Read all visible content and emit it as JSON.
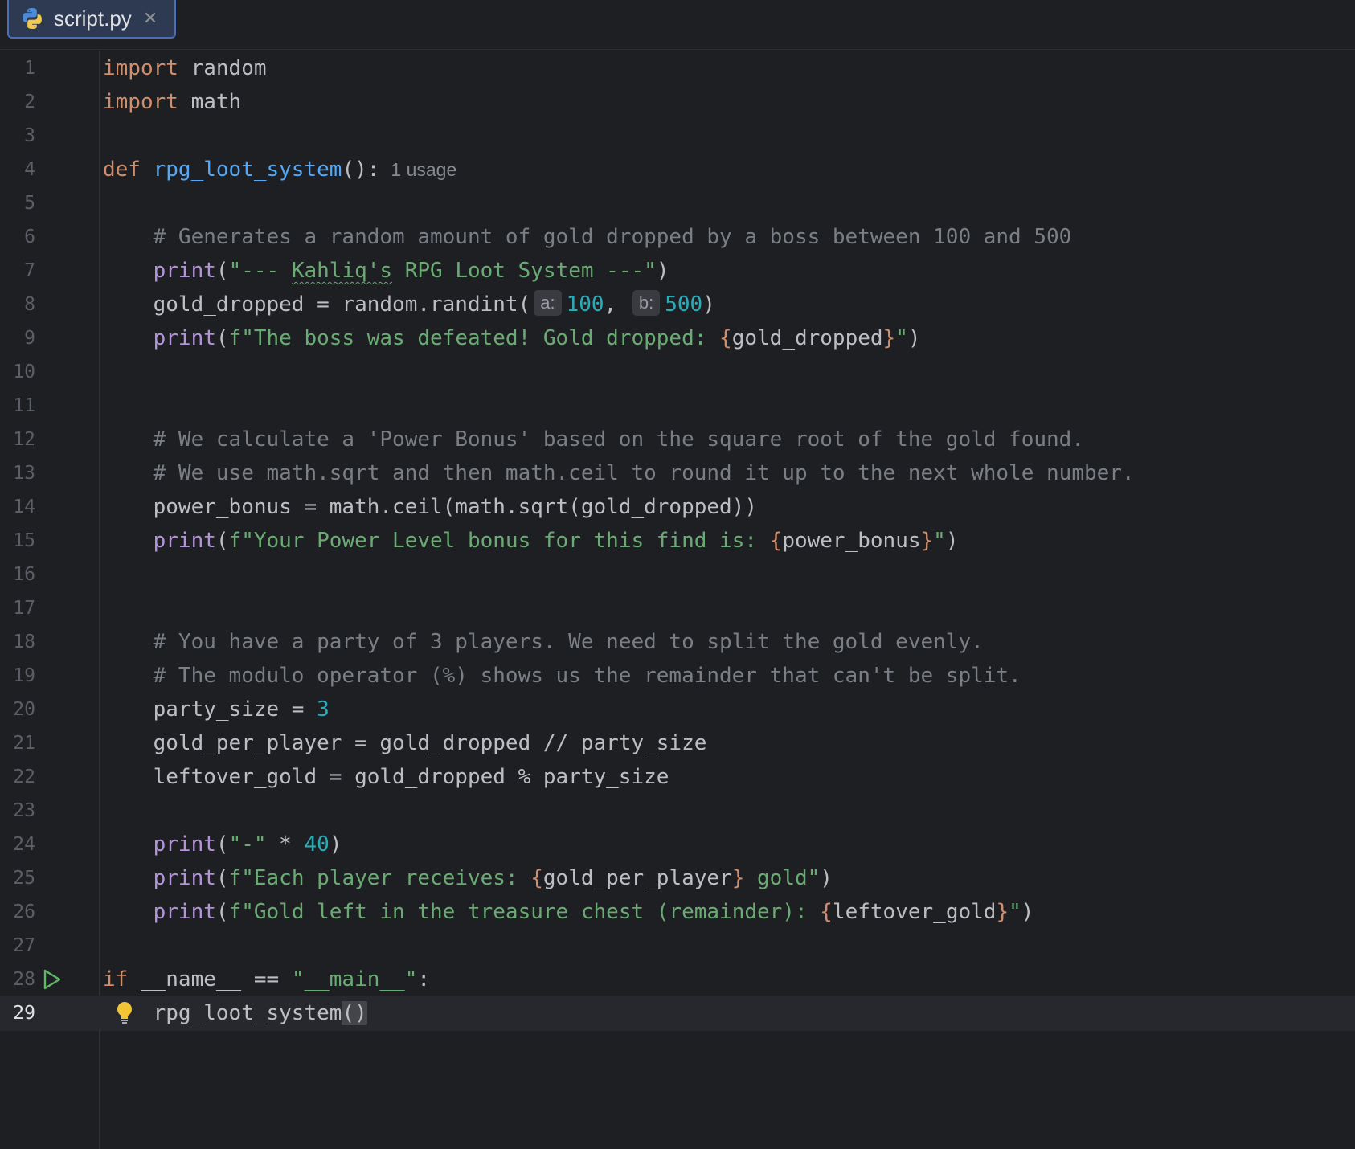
{
  "tab": {
    "filename": "script.py",
    "close_glyph": "✕",
    "icon": "python-file-icon"
  },
  "inlay": {
    "usage": "1 usage",
    "param_a": "a:",
    "param_b": "b:"
  },
  "colors": {
    "background": "#1e1f22",
    "keyword": "#cf8e6d",
    "function": "#56a8f5",
    "builtin": "#b394d9",
    "string": "#6aab73",
    "number": "#2aacb8",
    "comment": "#7a7e85"
  },
  "code": {
    "l1_kw": "import",
    "l1_rest": " random",
    "l2_kw": "import",
    "l2_rest": " math",
    "l4_kw": "def",
    "l4_fn": "rpg_loot_system",
    "l4_tail": "():",
    "l6": "# Generates a random amount of gold dropped by a boss between 100 and 500",
    "l7_fn": "print",
    "l7_open": "(",
    "l7_s1": "\"--- ",
    "l7_typo": "Kahliq's",
    "l7_s2": " RPG Loot System ---\"",
    "l7_close": ")",
    "l8_lhs": "gold_dropped = random.randint(",
    "l8_a": "100",
    "l8_comma": ",",
    "l8_b": "500",
    "l8_close": ")",
    "l9_fn": "print",
    "l9_open": "(",
    "l9_s1": "f\"The boss was defeated! Gold dropped: ",
    "l9_b1": "{",
    "l9_var": "gold_dropped",
    "l9_b2": "}",
    "l9_s2": "\"",
    "l9_close": ")",
    "l12": "# We calculate a 'Power Bonus' based on the square root of the gold found.",
    "l13": "# We use math.sqrt and then math.ceil to round it up to the next whole number.",
    "l14": "power_bonus = math.ceil(math.sqrt(gold_dropped))",
    "l15_fn": "print",
    "l15_open": "(",
    "l15_s1": "f\"Your Power Level bonus for this find is: ",
    "l15_b1": "{",
    "l15_var": "power_bonus",
    "l15_b2": "}",
    "l15_s2": "\"",
    "l15_close": ")",
    "l18": "# You have a party of 3 players. We need to split the gold evenly.",
    "l19": "# The modulo operator (%) shows us the remainder that can't be split.",
    "l20_lhs": "party_size = ",
    "l20_num": "3",
    "l21": "gold_per_player = gold_dropped // party_size",
    "l22": "leftover_gold = gold_dropped % party_size",
    "l24_fn": "print",
    "l24_open": "(",
    "l24_s": "\"-\"",
    "l24_op": " * ",
    "l24_num": "40",
    "l24_close": ")",
    "l25_fn": "print",
    "l25_open": "(",
    "l25_s1": "f\"Each player receives: ",
    "l25_b1": "{",
    "l25_var": "gold_per_player",
    "l25_b2": "}",
    "l25_s2": " gold\"",
    "l25_close": ")",
    "l26_fn": "print",
    "l26_open": "(",
    "l26_s1": "f\"Gold left in the treasure chest (remainder): ",
    "l26_b1": "{",
    "l26_var": "leftover_gold",
    "l26_b2": "}",
    "l26_s2": "\"",
    "l26_close": ")",
    "l28_kw": "if",
    "l28_mid": " __name__ == ",
    "l28_s": "\"__main__\"",
    "l28_colon": ":",
    "l29_call": "rpg_loot_system",
    "l29_parens": "()"
  },
  "line_numbers": [
    "1",
    "2",
    "3",
    "4",
    "5",
    "6",
    "7",
    "8",
    "9",
    "10",
    "11",
    "12",
    "13",
    "14",
    "15",
    "16",
    "17",
    "18",
    "19",
    "20",
    "21",
    "22",
    "23",
    "24",
    "25",
    "26",
    "27",
    "28",
    "29"
  ]
}
